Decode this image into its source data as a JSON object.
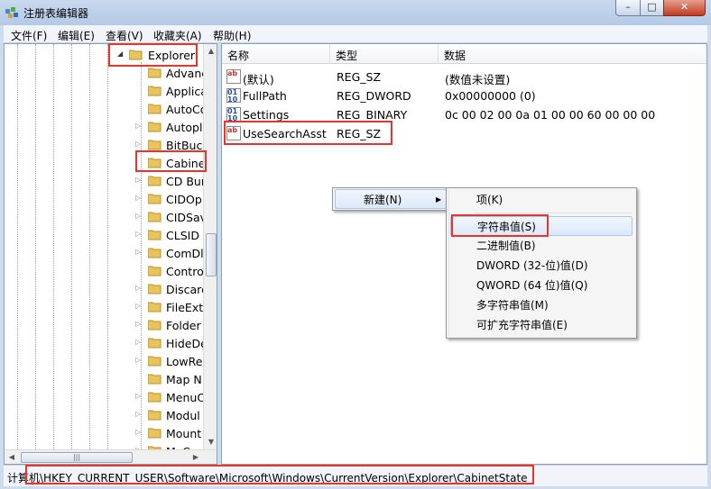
{
  "window": {
    "title": "注册表编辑器",
    "buttons": {
      "minimize": "–",
      "maximize": "□",
      "close": "✕"
    }
  },
  "menubar": [
    "文件(F)",
    "编辑(E)",
    "查看(V)",
    "收藏夹(A)",
    "帮助(H)"
  ],
  "tree": {
    "selected_parent": "Explorer",
    "children": [
      "Advanc",
      "Applica",
      "AutoCo",
      "Autopl",
      "BitBuck",
      "Cabine",
      "CD Bur",
      "CIDOp",
      "CIDSav",
      "CLSID",
      "ComDl",
      "Contro",
      "Discard",
      "FileExts",
      "Folder",
      "HideDe",
      "LowRe",
      "Map N",
      "MenuO",
      "Modul",
      "Mount",
      "MyC"
    ],
    "expandable": [
      false,
      false,
      false,
      true,
      true,
      false,
      true,
      true,
      true,
      true,
      true,
      false,
      true,
      true,
      true,
      true,
      true,
      false,
      true,
      true,
      true,
      true
    ]
  },
  "columns": [
    "名称",
    "类型",
    "数据"
  ],
  "values": [
    {
      "name": "(默认)",
      "type": "REG_SZ",
      "data": "(数值未设置)",
      "icon": "string-value-icon"
    },
    {
      "name": "FullPath",
      "type": "REG_DWORD",
      "data": "0x00000000 (0)",
      "icon": "binary-value-icon"
    },
    {
      "name": "Settings",
      "type": "REG_BINARY",
      "data": "0c 00 02 00 0a 01 00 00 60 00 00 00",
      "icon": "binary-value-icon"
    },
    {
      "name": "UseSearchAsst",
      "type": "REG_SZ",
      "data": "",
      "icon": "string-value-icon"
    }
  ],
  "context_menu": {
    "item": "新建(N)",
    "arrow": "▶"
  },
  "submenu": [
    "项(K)",
    "字符串值(S)",
    "二进制值(B)",
    "DWORD (32-位)值(D)",
    "QWORD (64 位)值(Q)",
    "多字符串值(M)",
    "可扩充字符串值(E)"
  ],
  "status": "计算机\\HKEY_CURRENT_USER\\Software\\Microsoft\\Windows\\CurrentVersion\\Explorer\\CabinetState",
  "colors": {
    "highlight_box": "#e8342a",
    "folder": "#e8c45a"
  }
}
